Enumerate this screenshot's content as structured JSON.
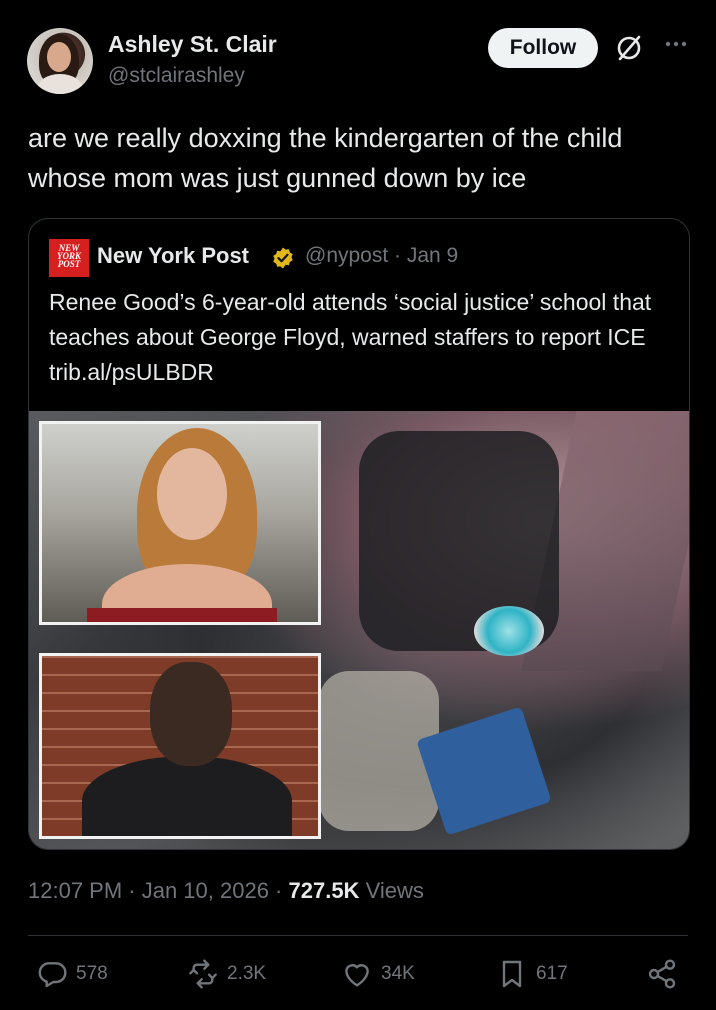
{
  "author": {
    "name": "Ashley St. Clair",
    "handle": "@stclairashley",
    "follow_label": "Follow"
  },
  "tweet": {
    "text": "are we really doxxing the kindergarten of the child whose mom was just gunned down by ice"
  },
  "quote": {
    "logo_text": "NEW YORK POST",
    "name": "New York Post",
    "handle_date": "@nypost · Jan 9",
    "text": "Renee Good’s 6-year-old attends ‘social justice’ school that teaches about George Floyd, warned staffers to report ICE trib.al/psULBDR"
  },
  "meta": {
    "time_date": "12:07 PM · Jan 10, 2026 · ",
    "views_count": "727.5K",
    "views_label": " Views"
  },
  "actions": {
    "replies": "578",
    "reposts": "2.3K",
    "likes": "34K",
    "bookmarks": "617"
  },
  "colors": {
    "background": "#000000",
    "text": "#e7e9ea",
    "secondary": "#71767b",
    "nyp_red": "#d6201f",
    "verified_gold": "#e2b719"
  },
  "icons": {
    "grok": "grok-icon",
    "more": "more-icon",
    "verified": "verified-badge-icon",
    "reply": "reply-icon",
    "repost": "repost-icon",
    "like": "heart-icon",
    "bookmark": "bookmark-icon",
    "share": "share-icon"
  }
}
